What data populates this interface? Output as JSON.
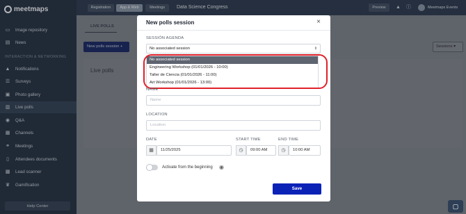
{
  "sidebar": {
    "logo": "meetmaps",
    "items": [
      {
        "label": "Image repository",
        "icon": "image-icon"
      },
      {
        "label": "News",
        "icon": "news-icon"
      },
      {
        "label": "Notifications",
        "icon": "bell-icon"
      },
      {
        "label": "Surveys",
        "icon": "survey-icon"
      },
      {
        "label": "Photo gallery",
        "icon": "photo-icon"
      },
      {
        "label": "Live polls",
        "icon": "poll-icon",
        "active": true
      },
      {
        "label": "Q&A",
        "icon": "qa-icon"
      },
      {
        "label": "Channels",
        "icon": "channel-icon"
      },
      {
        "label": "Meetings",
        "icon": "meetings-icon"
      },
      {
        "label": "Attendees documents",
        "icon": "document-icon"
      },
      {
        "label": "Lead scanner",
        "icon": "qr-icon"
      },
      {
        "label": "Gamification",
        "icon": "trophy-icon"
      }
    ],
    "section_label": "INTERACTION & NETWORKING",
    "help": "Help Center"
  },
  "topbar": {
    "tabs": [
      "Registration",
      "App & Web",
      "Meetings"
    ],
    "active_tab": "App & Web",
    "event_name": "Data Science Congress",
    "preview": "Preview",
    "user": "Meetmaps Events"
  },
  "main": {
    "subtab": "LIVE POLLS",
    "new_button": "New polls session  +",
    "sessions_button": "Sessions  ▾",
    "card_title": "Live polls"
  },
  "modal": {
    "title": "New polls session",
    "session_agenda_label": "SESSIÓN AGENDA",
    "session_selected": "No associated session",
    "options": [
      "No associated session",
      "Engineering Workshop (01/01/2026 - 10:00)",
      "Taller de Ciencia (01/01/2026 - 11:00)",
      "Art Workshop (01/01/2026 - 13:00)"
    ],
    "name_label": "NAME",
    "name_placeholder": "Name",
    "location_label": "LOCATION",
    "location_placeholder": "Location",
    "date_label": "DATE",
    "date_value": "11/25/2025",
    "start_label": "START TIME",
    "start_value": "09:00 AM",
    "end_label": "END TIME",
    "end_value": "10:00 AM",
    "toggle_label": "Activate from the beginning",
    "save": "Save"
  },
  "colors": {
    "primary": "#0b22b7",
    "highlight_ring": "#e0202a",
    "sidebar_bg": "#1d2a3a"
  }
}
